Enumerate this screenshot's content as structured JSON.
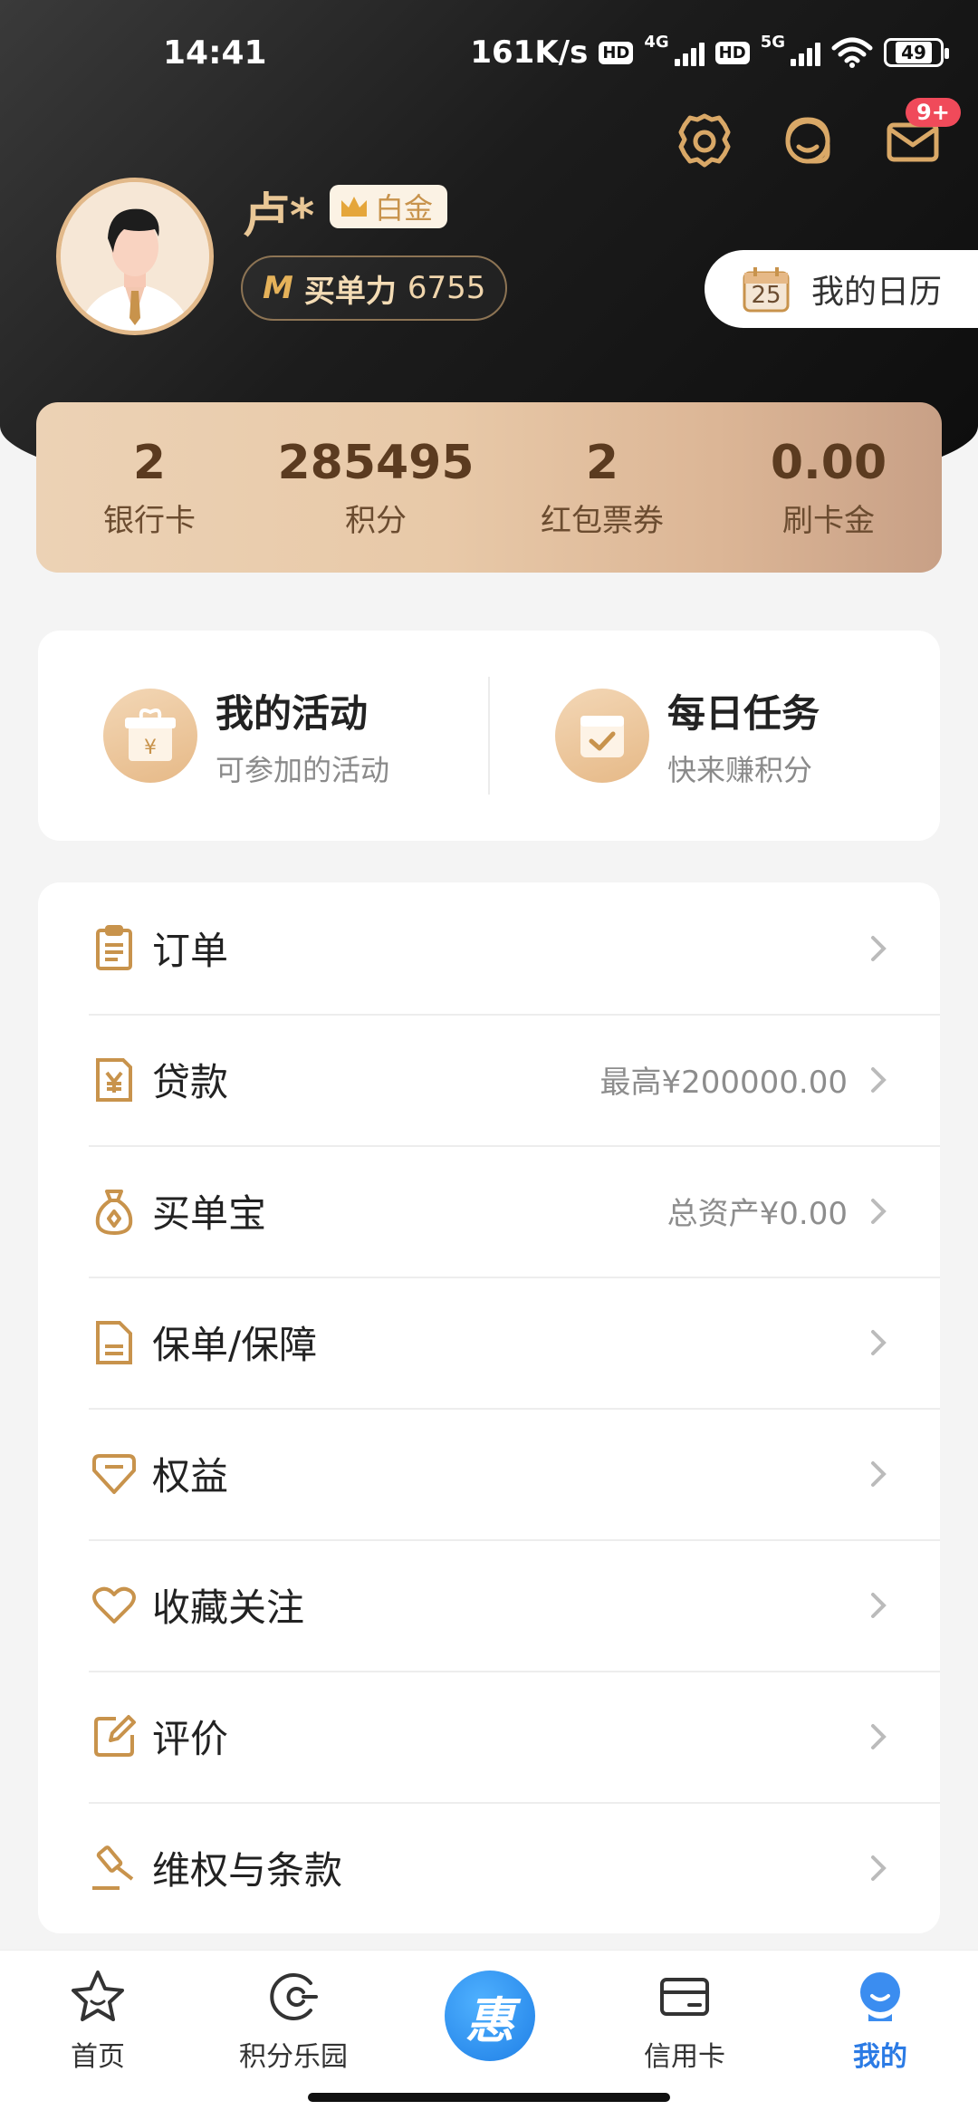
{
  "status_bar": {
    "time": "14:41",
    "speed": "161K/s",
    "hd1": "HD",
    "net1": "4G",
    "hd2": "HD",
    "net2": "5G",
    "battery": "49"
  },
  "header": {
    "message_badge": "9+"
  },
  "profile": {
    "name": "卢*",
    "tier": "白金",
    "power_label": "买单力",
    "power_value": "6755",
    "calendar_day": "25",
    "calendar_label": "我的日历"
  },
  "stats": [
    {
      "value": "2",
      "label": "银行卡"
    },
    {
      "value": "285495",
      "label": "积分"
    },
    {
      "value": "2",
      "label": "红包票券"
    },
    {
      "value": "0.00",
      "label": "刷卡金"
    }
  ],
  "activities": [
    {
      "title": "我的活动",
      "subtitle": "可参加的活动",
      "icon": "gift-box-icon"
    },
    {
      "title": "每日任务",
      "subtitle": "快来赚积分",
      "icon": "calendar-check-icon"
    }
  ],
  "menu": [
    {
      "label": "订单",
      "extra": "",
      "icon": "clipboard-icon"
    },
    {
      "label": "贷款",
      "extra": "最高¥200000.00",
      "icon": "yuan-document-icon"
    },
    {
      "label": "买单宝",
      "extra": "总资产¥0.00",
      "icon": "money-bag-icon"
    },
    {
      "label": "保单/保障",
      "extra": "",
      "icon": "document-icon"
    },
    {
      "label": "权益",
      "extra": "",
      "icon": "diamond-icon"
    },
    {
      "label": "收藏关注",
      "extra": "",
      "icon": "heart-icon"
    },
    {
      "label": "评价",
      "extra": "",
      "icon": "edit-icon"
    },
    {
      "label": "维权与条款",
      "extra": "",
      "icon": "gavel-icon"
    }
  ],
  "tabs": [
    {
      "label": "首页",
      "icon": "star-icon",
      "active": false
    },
    {
      "label": "积分乐园",
      "icon": "points-icon",
      "active": false
    },
    {
      "label": "",
      "icon": "center-logo-icon",
      "active": false
    },
    {
      "label": "信用卡",
      "icon": "card-icon",
      "active": false
    },
    {
      "label": "我的",
      "icon": "profile-icon",
      "active": true
    }
  ],
  "center_button_glyph": "惠",
  "colors": {
    "accent_gold": "#c8934c",
    "active_blue": "#2b7be5",
    "badge_red": "#f04a5a"
  }
}
